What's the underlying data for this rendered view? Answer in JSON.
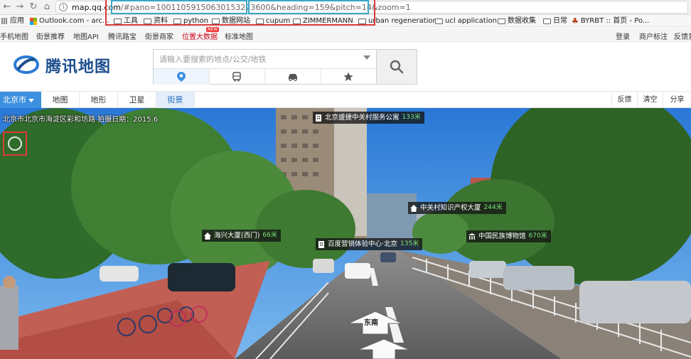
{
  "browser": {
    "url_host": "map.qq.com",
    "url_rest": "/#pano=10011059150630153223600&heading=159&pitch=14&zoom=1",
    "bookmarks": [
      {
        "label": "应用",
        "icon": "apps-grid-icon"
      },
      {
        "label": "Outlook.com - arc...",
        "icon": "outlook-icon"
      },
      {
        "label": "工具",
        "icon": "folder-icon"
      },
      {
        "label": "资料",
        "icon": "folder-icon"
      },
      {
        "label": "python",
        "icon": "folder-icon"
      },
      {
        "label": "数据网站",
        "icon": "folder-icon"
      },
      {
        "label": "cupum",
        "icon": "folder-icon"
      },
      {
        "label": "ZIMMERMANN",
        "icon": "folder-icon"
      },
      {
        "label": "urban regeneration",
        "icon": "folder-icon"
      },
      {
        "label": "ucl application",
        "icon": "folder-icon"
      },
      {
        "label": "数据收集",
        "icon": "folder-icon"
      },
      {
        "label": "日常",
        "icon": "folder-icon"
      },
      {
        "label": "BYRBT :: 首页 - Po...",
        "icon": "byrbt-icon"
      }
    ]
  },
  "toplinks": {
    "left": [
      "手机地图",
      "街景推荐",
      "地图API",
      "腾讯路宝",
      "街景商家",
      "位置大数据",
      "标准地图"
    ],
    "hot_badge": "NEW",
    "right": [
      "登录",
      "商户标注",
      "反馈意"
    ]
  },
  "header": {
    "logo_text": "腾讯地图",
    "search_placeholder": "请输入要搜索的地点/公交/地铁",
    "modes": [
      "location-icon",
      "bus-icon",
      "car-icon",
      "star-icon"
    ]
  },
  "toolbar": {
    "city": "北京市",
    "tabs": [
      "地图",
      "地形",
      "卫星",
      "街景"
    ],
    "active_tab": "街景",
    "right": [
      "反馈",
      "清空",
      "分享"
    ]
  },
  "streetview": {
    "address": "北京市北京市海淀区彩和坊路  拍摄日期：2015.6",
    "direction_label": "东南",
    "pois": [
      {
        "name": "北京盛捷中关村服务公寓",
        "dist": "133米",
        "icon": "building-icon"
      },
      {
        "name": "中关村知识产权大厦",
        "dist": "244米",
        "icon": "house-icon"
      },
      {
        "name": "海兴大厦(西门)",
        "dist": "66米",
        "icon": "house-icon"
      },
      {
        "name": "百度营销体验中心·北京",
        "dist": "135米",
        "icon": "building-icon"
      },
      {
        "name": "中国民族博物馆",
        "dist": "670米",
        "icon": "museum-icon"
      }
    ]
  },
  "colors": {
    "brand_blue": "#3d8fe0",
    "logo_blue": "#1d4f8c",
    "annotation_red": "#d83a3a",
    "annotation_teal": "#3aa8c4",
    "poi_distance_green": "#7ae37a"
  }
}
